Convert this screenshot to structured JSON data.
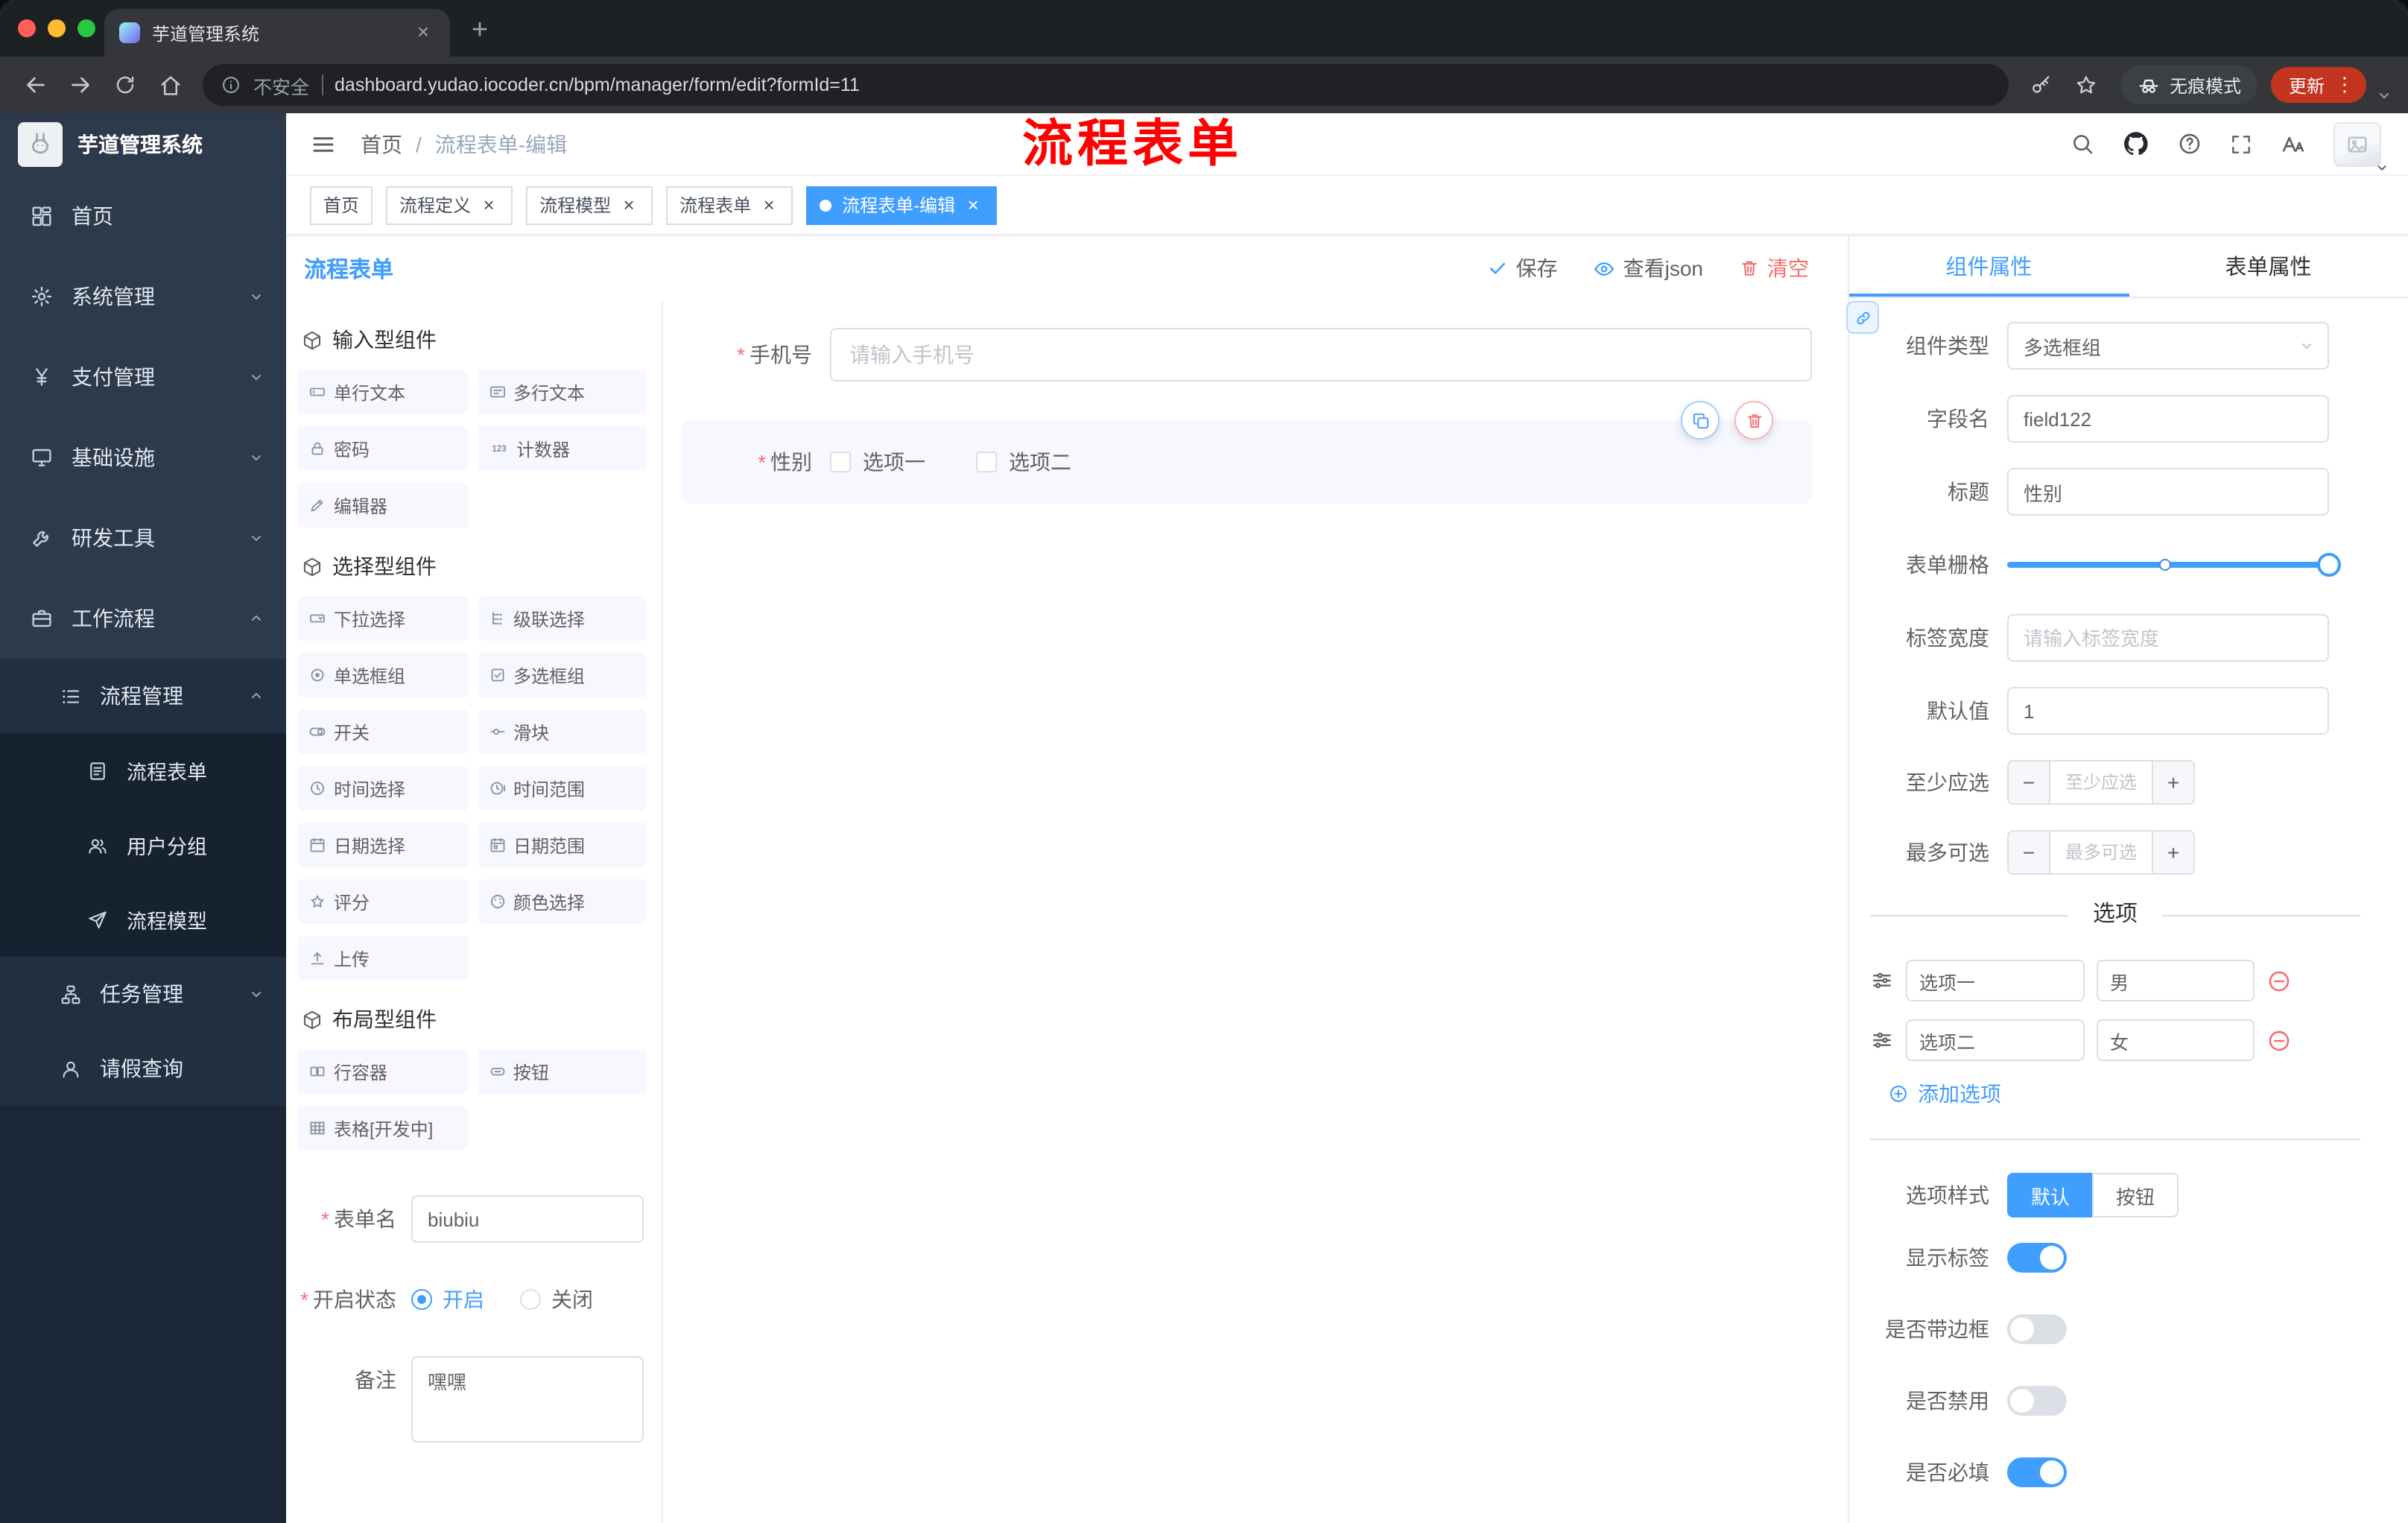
{
  "colors": {
    "accent": "#409eff",
    "danger": "#f56c6c",
    "sidebar_bg": "#2d3a4b",
    "update_red": "#c5341f"
  },
  "browser": {
    "tab_title": "芋道管理系统",
    "security_label": "不安全",
    "url": "dashboard.yudao.iocoder.cn/bpm/manager/form/edit?formId=11",
    "incognito_label": "无痕模式",
    "update_label": "更新"
  },
  "sidebar": {
    "logo_title": "芋道管理系统",
    "items": [
      {
        "label": "首页",
        "icon": "dashboard-icon"
      },
      {
        "label": "系统管理",
        "icon": "gear-icon"
      },
      {
        "label": "支付管理",
        "icon": "yen-icon"
      },
      {
        "label": "基础设施",
        "icon": "monitor-icon"
      },
      {
        "label": "研发工具",
        "icon": "tool-icon"
      },
      {
        "label": "工作流程",
        "icon": "briefcase-icon"
      },
      {
        "label": "流程管理",
        "icon": "list-icon"
      },
      {
        "label": "流程表单",
        "icon": "document-icon"
      },
      {
        "label": "用户分组",
        "icon": "users-icon"
      },
      {
        "label": "流程模型",
        "icon": "send-icon"
      },
      {
        "label": "任务管理",
        "icon": "tree-icon"
      },
      {
        "label": "请假查询",
        "icon": "person-icon"
      }
    ]
  },
  "header": {
    "breadcrumb_home": "首页",
    "breadcrumb_current": "流程表单-编辑",
    "annotation": "流程表单"
  },
  "tags": [
    {
      "label": "首页",
      "closable": false,
      "active": false
    },
    {
      "label": "流程定义",
      "closable": true,
      "active": false
    },
    {
      "label": "流程模型",
      "closable": true,
      "active": false
    },
    {
      "label": "流程表单",
      "closable": true,
      "active": false
    },
    {
      "label": "流程表单-编辑",
      "closable": true,
      "active": true
    }
  ],
  "designer": {
    "title": "流程表单",
    "actions": {
      "save": "保存",
      "view_json": "查看json",
      "clear": "清空"
    },
    "palette": {
      "sections": [
        {
          "title": "输入型组件",
          "items": [
            {
              "label": "单行文本",
              "icon": "input-icon"
            },
            {
              "label": "多行文本",
              "icon": "textarea-icon"
            },
            {
              "label": "密码",
              "icon": "lock-icon"
            },
            {
              "label": "计数器",
              "icon": "number-icon"
            },
            {
              "label": "编辑器",
              "icon": "editor-icon"
            }
          ]
        },
        {
          "title": "选择型组件",
          "items": [
            {
              "label": "下拉选择",
              "icon": "select-icon"
            },
            {
              "label": "级联选择",
              "icon": "cascader-icon"
            },
            {
              "label": "单选框组",
              "icon": "radio-icon"
            },
            {
              "label": "多选框组",
              "icon": "checkbox-icon"
            },
            {
              "label": "开关",
              "icon": "switch-icon"
            },
            {
              "label": "滑块",
              "icon": "slider-icon"
            },
            {
              "label": "时间选择",
              "icon": "time-icon"
            },
            {
              "label": "时间范围",
              "icon": "time-range-icon"
            },
            {
              "label": "日期选择",
              "icon": "date-icon"
            },
            {
              "label": "日期范围",
              "icon": "date-range-icon"
            },
            {
              "label": "评分",
              "icon": "rate-icon"
            },
            {
              "label": "颜色选择",
              "icon": "color-icon"
            },
            {
              "label": "上传",
              "icon": "upload-icon"
            }
          ]
        },
        {
          "title": "布局型组件",
          "items": [
            {
              "label": "行容器",
              "icon": "row-icon"
            },
            {
              "label": "按钮",
              "icon": "button-icon"
            },
            {
              "label": "表格[开发中]",
              "icon": "table-icon"
            }
          ]
        }
      ]
    },
    "meta": {
      "form_name_label": "表单名",
      "form_name_value": "biubiu",
      "status_label": "开启状态",
      "status_on": "开启",
      "status_off": "关闭",
      "remark_label": "备注",
      "remark_value": "嘿嘿"
    },
    "canvas": {
      "phone_label": "手机号",
      "phone_placeholder": "请输入手机号",
      "gender_label": "性别",
      "gender_option1": "选项一",
      "gender_option2": "选项二"
    }
  },
  "props": {
    "tab_component": "组件属性",
    "tab_form": "表单属性",
    "component_type_label": "组件类型",
    "component_type_value": "多选框组",
    "field_name_label": "字段名",
    "field_name_value": "field122",
    "title_label": "标题",
    "title_value": "性别",
    "grid_label": "表单栅格",
    "label_width_label": "标签宽度",
    "label_width_placeholder": "请输入标签宽度",
    "default_label": "默认值",
    "default_value": "1",
    "min_label": "至少应选",
    "min_placeholder": "至少应选",
    "max_label": "最多可选",
    "max_placeholder": "最多可选",
    "options_title": "选项",
    "options": [
      {
        "label": "选项一",
        "value": "男"
      },
      {
        "label": "选项二",
        "value": "女"
      }
    ],
    "add_option": "添加选项",
    "style_label": "选项样式",
    "style_default": "默认",
    "style_button": "按钮",
    "show_label": "显示标签",
    "border_label": "是否带边框",
    "disabled_label": "是否禁用",
    "required_label": "是否必填"
  }
}
